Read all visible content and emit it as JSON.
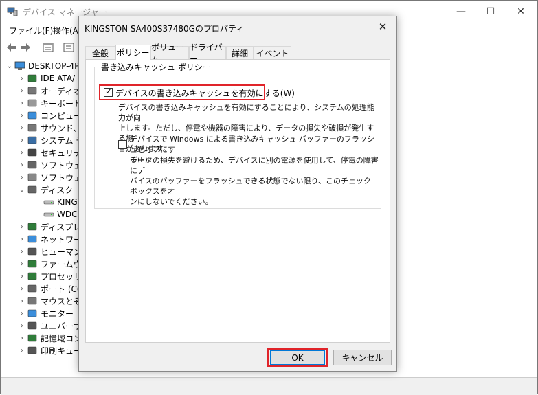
{
  "main_window": {
    "title": "デバイス マネージャー",
    "window_controls": {
      "minimize": "—",
      "maximize": "☐",
      "close": "✕"
    },
    "menu": [
      "ファイル(F)",
      "操作(A"
    ],
    "toolbar_icons": [
      "back-arrow-icon",
      "forward-arrow-icon",
      "properties-icon",
      "help-icon"
    ],
    "tree": {
      "root": "DESKTOP-4P",
      "items": [
        {
          "label": "IDE ATA/",
          "icon": "ide-controller-icon",
          "expanded": false
        },
        {
          "label": "オーディオの",
          "icon": "speaker-icon",
          "expanded": false
        },
        {
          "label": "キーボード",
          "icon": "keyboard-icon",
          "expanded": false
        },
        {
          "label": "コンピュータ",
          "icon": "computer-icon",
          "expanded": false
        },
        {
          "label": "サウンド、",
          "icon": "speaker-icon",
          "expanded": false
        },
        {
          "label": "システム デ",
          "icon": "system-device-icon",
          "expanded": false
        },
        {
          "label": "セキュリティ",
          "icon": "security-device-icon",
          "expanded": false
        },
        {
          "label": "ソフトウェア",
          "icon": "software-component-icon",
          "expanded": false
        },
        {
          "label": "ソフトウェア",
          "icon": "software-device-icon",
          "expanded": false
        },
        {
          "label": "ディスク ド",
          "icon": "disk-drive-icon",
          "expanded": true,
          "children": [
            {
              "label": "KING"
            },
            {
              "label": "WDC"
            }
          ]
        },
        {
          "label": "ディスプレ",
          "icon": "display-adapter-icon",
          "expanded": false
        },
        {
          "label": "ネットワーク",
          "icon": "network-adapter-icon",
          "expanded": false
        },
        {
          "label": "ヒューマン イ",
          "icon": "hid-icon",
          "expanded": false
        },
        {
          "label": "ファームウェ",
          "icon": "firmware-icon",
          "expanded": false
        },
        {
          "label": "プロセッサ",
          "icon": "processor-icon",
          "expanded": false
        },
        {
          "label": "ポート (CO",
          "icon": "port-icon",
          "expanded": false
        },
        {
          "label": "マウスとそ",
          "icon": "mouse-icon",
          "expanded": false
        },
        {
          "label": "モニター",
          "icon": "monitor-icon",
          "expanded": false
        },
        {
          "label": "ユニバーサ",
          "icon": "usb-controller-icon",
          "expanded": false
        },
        {
          "label": "記憶域コン",
          "icon": "storage-controller-icon",
          "expanded": false
        },
        {
          "label": "印刷キュー",
          "icon": "printer-icon",
          "expanded": false
        }
      ]
    }
  },
  "dialog": {
    "title": "KINGSTON SA400S37480Gのプロパティ",
    "close_glyph": "✕",
    "tabs": [
      {
        "label": "全般",
        "active": false
      },
      {
        "label": "ポリシー",
        "active": true
      },
      {
        "label": "ボリューム",
        "active": false
      },
      {
        "label": "ドライバー",
        "active": false
      },
      {
        "label": "詳細",
        "active": false
      },
      {
        "label": "イベント",
        "active": false
      }
    ],
    "group_title": "書き込みキャッシュ ポリシー",
    "write_cache": {
      "label": "デバイスの書き込みキャッシュを有効にする(W)",
      "checked": true,
      "description": [
        "デバイスの書き込みキャッシュを有効にすることにより、システムの処理能力が向",
        "上します。ただし、停電や機器の障害により、データの損失や破損が発生する場",
        "合があります。"
      ]
    },
    "flush_off": {
      "label_lines": [
        "デバイスで Windows による書き込みキャッシュ バッファーのフラッシュをオフにす",
        "る(F)"
      ],
      "checked": false,
      "description": [
        "データの損失を避けるため、デバイスに別の電源を使用して、停電の障害にデ",
        "バイスのバッファーをフラッシュできる状態でない限り、このチェック ボックスをオ",
        "ンにしないでください。"
      ]
    },
    "ok_label": "OK",
    "cancel_label": "キャンセル",
    "highlight_color": "#e0242a",
    "focus_color": "#0078d7"
  }
}
